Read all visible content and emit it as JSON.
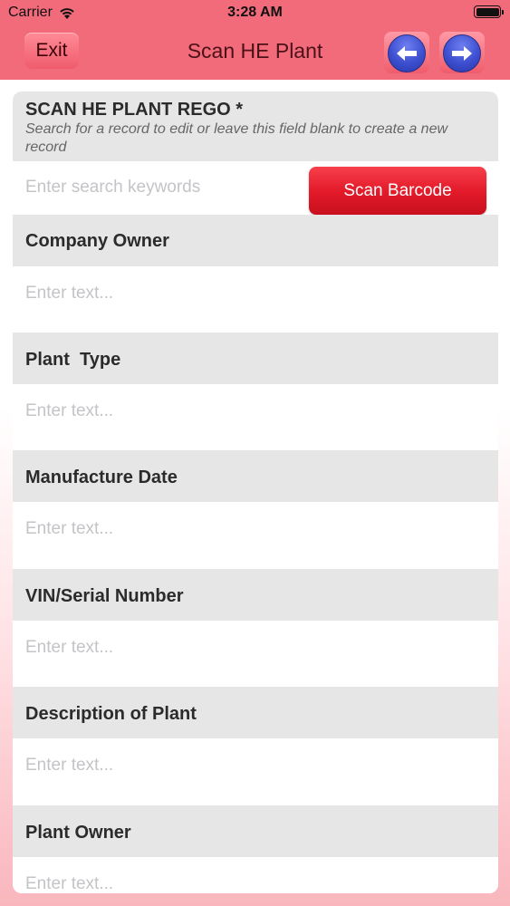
{
  "status_bar": {
    "carrier": "Carrier",
    "time": "3:28 AM"
  },
  "navbar": {
    "exit_label": "Exit",
    "title": "Scan HE Plant",
    "back_icon": "arrow-left-icon",
    "forward_icon": "arrow-right-icon"
  },
  "form": {
    "rego": {
      "label": "SCAN HE PLANT REGO *",
      "hint": "Search for a record to edit or leave this field blank to create a new record",
      "placeholder": "Enter search keywords",
      "scan_button": "Scan Barcode"
    },
    "fields": [
      {
        "label": "Company Owner",
        "placeholder": "Enter text..."
      },
      {
        "label": "Plant  Type",
        "placeholder": "Enter text..."
      },
      {
        "label": "Manufacture Date",
        "placeholder": "Enter text..."
      },
      {
        "label": "VIN/Serial Number",
        "placeholder": "Enter text..."
      },
      {
        "label": "Description of Plant",
        "placeholder": "Enter text..."
      },
      {
        "label": "Plant Owner",
        "placeholder": "Enter text..."
      }
    ]
  },
  "colors": {
    "header": "#f26b7b",
    "scan_button": "#e41b2a",
    "nav_circle": "#3d4fd0",
    "section_header": "#e6e6e7"
  }
}
